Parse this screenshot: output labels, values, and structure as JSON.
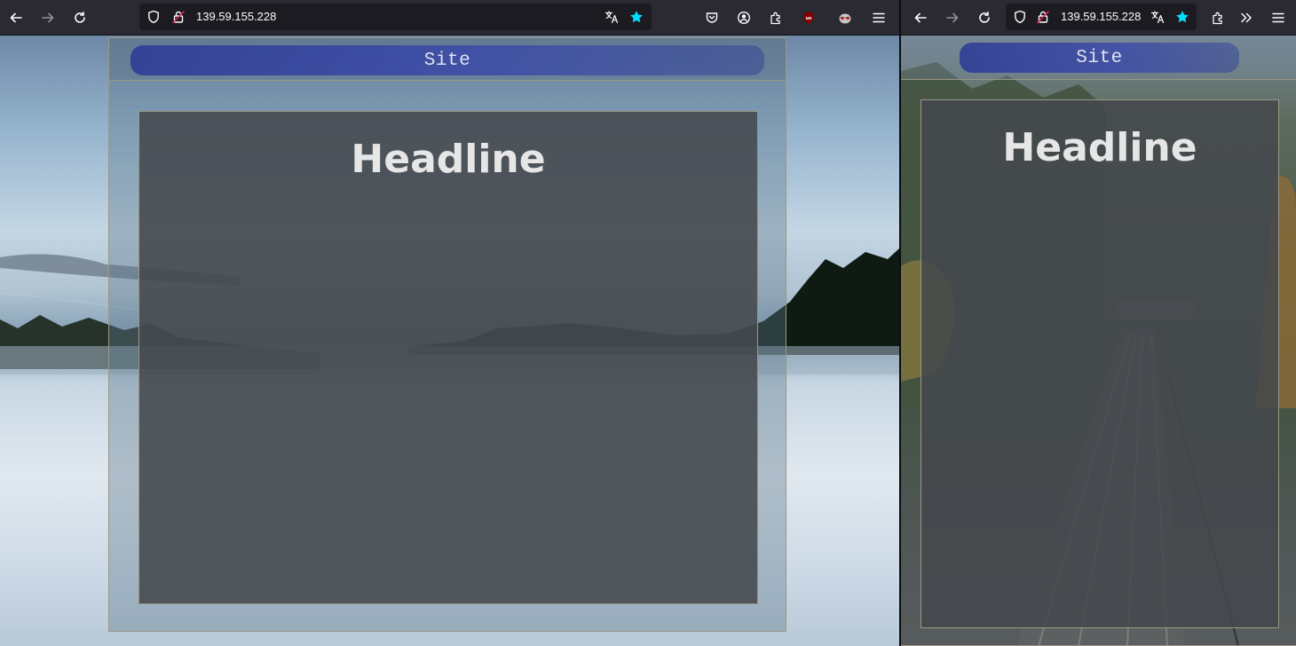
{
  "browser_left": {
    "url": "139.59.155.228",
    "toolbar_icons": [
      "back-icon",
      "forward-icon",
      "reload-icon",
      "shield-icon",
      "insecure-lock-icon",
      "translate-icon",
      "bookmark-star-icon",
      "pocket-icon",
      "account-icon",
      "extensions-icon",
      "ublock-icon",
      "privacy-badger-icon",
      "menu-icon"
    ],
    "ublock_badge": "uo"
  },
  "browser_right": {
    "url": "139.59.155.228",
    "toolbar_icons": [
      "back-icon",
      "forward-icon",
      "reload-icon",
      "shield-icon",
      "insecure-lock-icon",
      "translate-icon",
      "bookmark-star-icon",
      "extensions-icon",
      "overflow-icon",
      "menu-icon"
    ]
  },
  "page": {
    "site_title": "Site",
    "headline": "Headline"
  },
  "colors": {
    "toolbar_bg": "#2b2a33",
    "urlbar_bg": "#1c1b22",
    "star_accent": "#00ddff",
    "site_pill": "#2f3e9a",
    "content_box": "#45494d",
    "frame_border": "#9a9785",
    "headline_text": "#e6e6e6"
  }
}
